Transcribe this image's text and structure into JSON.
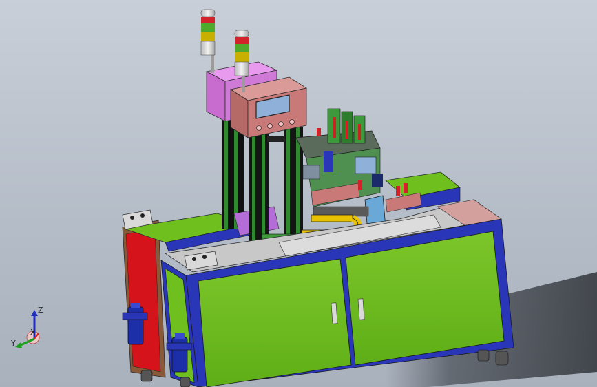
{
  "viewport": {
    "background_top": "#c9cfd8",
    "background_bottom": "#a9b1bd"
  },
  "machine": {
    "frame_color": "#2a36b8",
    "panel_color": "#6fbf1f",
    "side_panel_color": "#d4141a",
    "console_color": "#c97a78",
    "box_color": "#d07ad8",
    "tabletop_color": "#cfcfcf"
  },
  "triad": {
    "z_label": "Z",
    "y_label": "Y",
    "x_label": "X"
  }
}
